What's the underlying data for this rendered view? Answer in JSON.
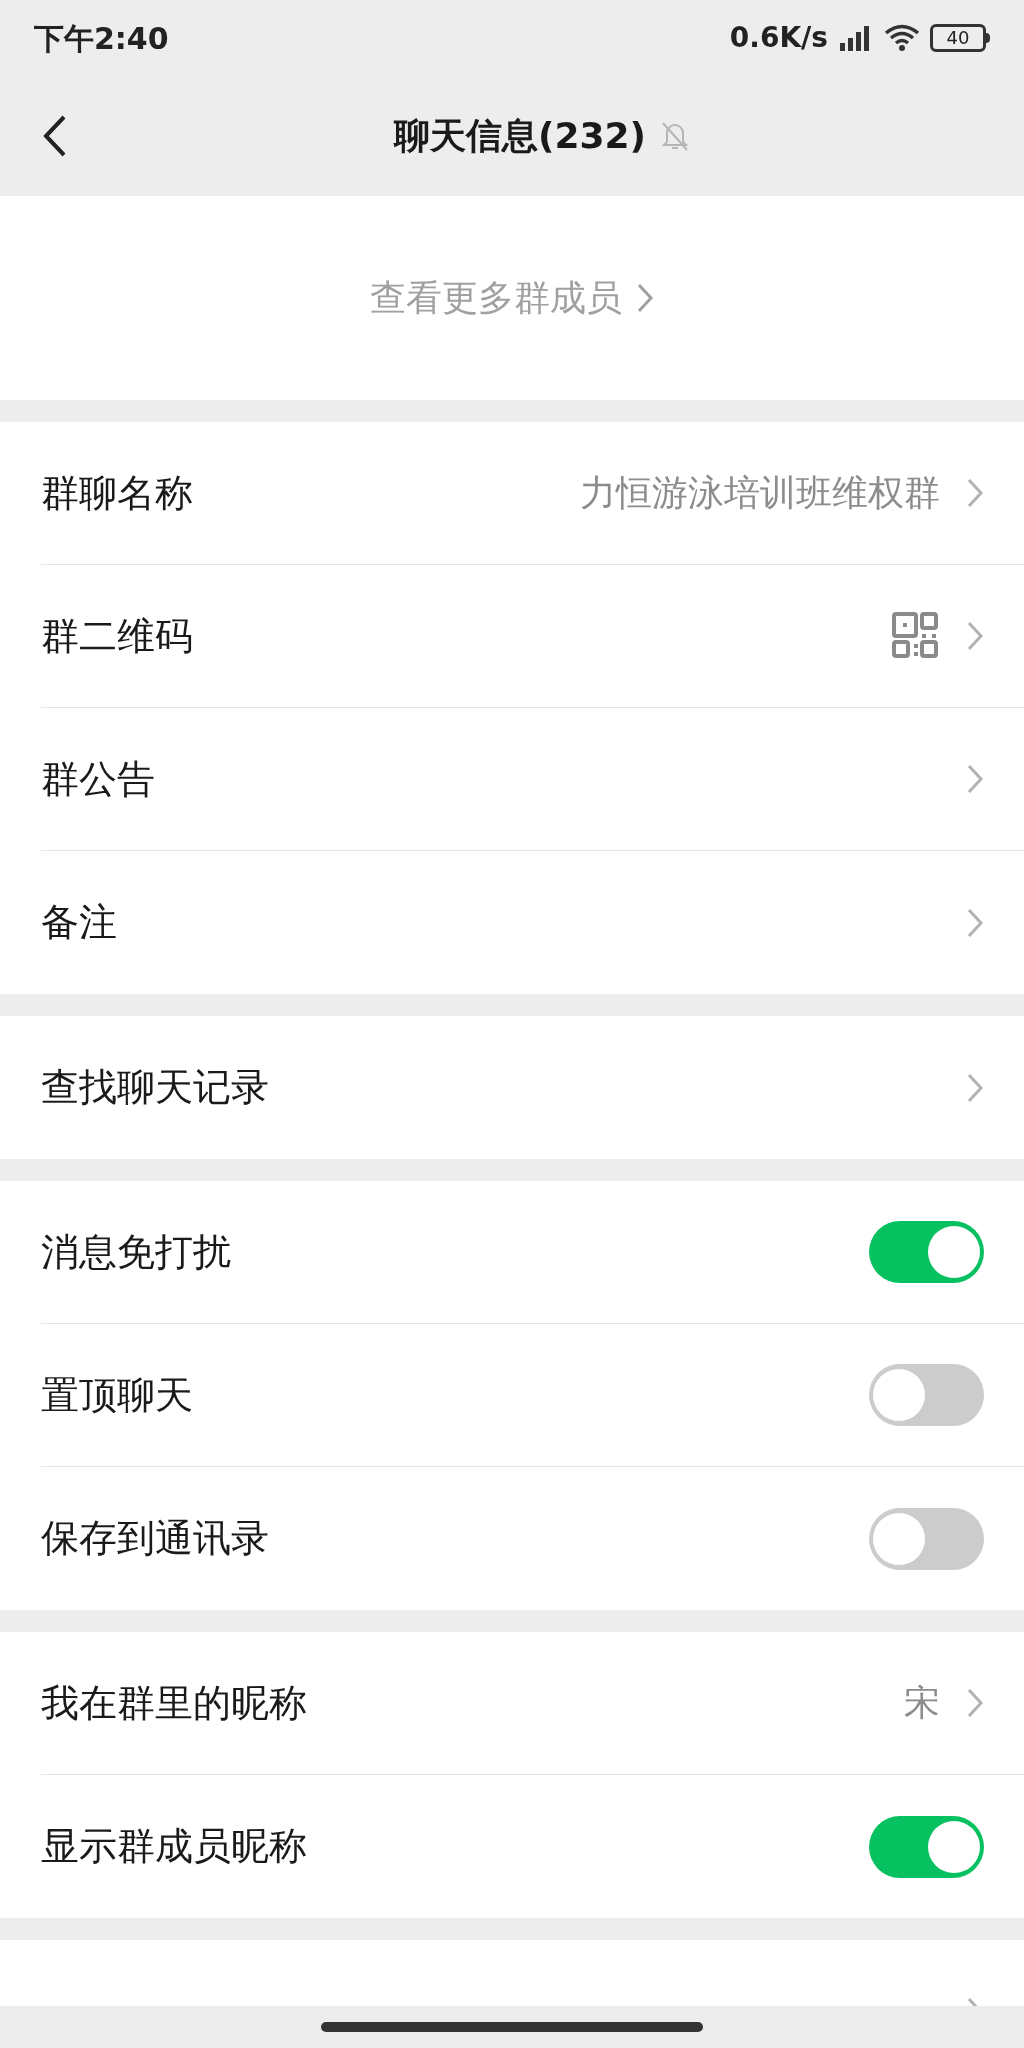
{
  "status_bar": {
    "time": "下午2:40",
    "speed": "0.6K/s",
    "battery": "40"
  },
  "header": {
    "title": "聊天信息(232)",
    "muted": true
  },
  "members": {
    "link": "查看更多群成员"
  },
  "sections": [
    {
      "rows": [
        {
          "kind": "link",
          "label": "群聊名称",
          "value": "力恒游泳培训班维权群"
        },
        {
          "kind": "qr",
          "label": "群二维码"
        },
        {
          "kind": "link",
          "label": "群公告"
        },
        {
          "kind": "link",
          "label": "备注"
        }
      ]
    },
    {
      "rows": [
        {
          "kind": "link",
          "label": "查找聊天记录"
        }
      ]
    },
    {
      "rows": [
        {
          "kind": "toggle",
          "label": "消息免打扰",
          "on": true
        },
        {
          "kind": "toggle",
          "label": "置顶聊天",
          "on": false
        },
        {
          "kind": "toggle",
          "label": "保存到通讯录",
          "on": false
        }
      ]
    },
    {
      "rows": [
        {
          "kind": "link",
          "label": "我在群里的昵称",
          "value": "宋"
        },
        {
          "kind": "toggle",
          "label": "显示群成员昵称",
          "on": true
        }
      ]
    },
    {
      "rows": [
        {
          "kind": "link"
        }
      ]
    }
  ]
}
